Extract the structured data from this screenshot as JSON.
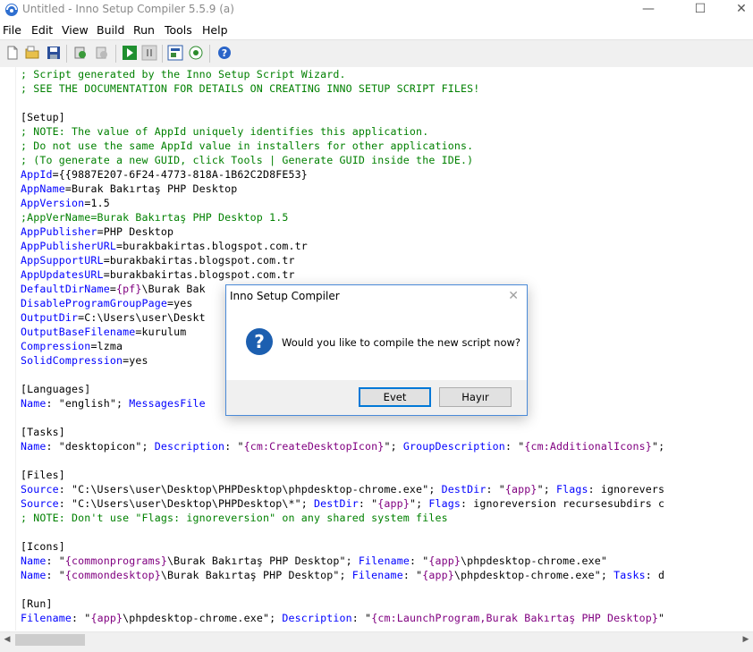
{
  "window": {
    "title": "Untitled - Inno Setup Compiler 5.5.9 (a)",
    "minimize_glyph": "—",
    "maximize_glyph": "☐",
    "close_glyph": "✕"
  },
  "menu": [
    "File",
    "Edit",
    "View",
    "Build",
    "Run",
    "Tools",
    "Help"
  ],
  "toolbar_icons": [
    "new-file-icon",
    "open-folder-icon",
    "save-icon",
    "compile-icon",
    "stop-compile-icon",
    "run-icon",
    "pause-icon",
    "wizard-icon",
    "target-icon",
    "help-icon"
  ],
  "editor": {
    "lines": [
      [
        {
          "t": "; Script generated by the Inno Setup Script Wizard.",
          "c": "cmt"
        }
      ],
      [
        {
          "t": "; SEE THE DOCUMENTATION FOR DETAILS ON CREATING INNO SETUP SCRIPT FILES!",
          "c": "cmt"
        }
      ],
      [],
      [
        {
          "t": "[Setup]",
          "c": "sec"
        }
      ],
      [
        {
          "t": "; NOTE: The value of AppId uniquely identifies this application.",
          "c": "cmt"
        }
      ],
      [
        {
          "t": "; Do not use the same AppId value in installers for other applications.",
          "c": "cmt"
        }
      ],
      [
        {
          "t": "; (To generate a new GUID, click Tools | Generate GUID inside the IDE.)",
          "c": "cmt"
        }
      ],
      [
        {
          "t": "AppId",
          "c": "key"
        },
        {
          "t": "={{9887E207-6F24-4773-818A-1B62C2D8FE53}",
          "c": ""
        }
      ],
      [
        {
          "t": "AppName",
          "c": "key"
        },
        {
          "t": "=Burak Bakırtaş PHP Desktop",
          "c": ""
        }
      ],
      [
        {
          "t": "AppVersion",
          "c": "key"
        },
        {
          "t": "=1.5",
          "c": ""
        }
      ],
      [
        {
          "t": ";AppVerName=Burak Bakırtaş PHP Desktop 1.5",
          "c": "cmt"
        }
      ],
      [
        {
          "t": "AppPublisher",
          "c": "key"
        },
        {
          "t": "=PHP Desktop",
          "c": ""
        }
      ],
      [
        {
          "t": "AppPublisherURL",
          "c": "key"
        },
        {
          "t": "=burakbakirtas.blogspot.com.tr",
          "c": ""
        }
      ],
      [
        {
          "t": "AppSupportURL",
          "c": "key"
        },
        {
          "t": "=burakbakirtas.blogspot.com.tr",
          "c": ""
        }
      ],
      [
        {
          "t": "AppUpdatesURL",
          "c": "key"
        },
        {
          "t": "=burakbakirtas.blogspot.com.tr",
          "c": ""
        }
      ],
      [
        {
          "t": "DefaultDirName",
          "c": "key"
        },
        {
          "t": "=",
          "c": ""
        },
        {
          "t": "{pf}",
          "c": "cst"
        },
        {
          "t": "\\Burak Bak",
          "c": ""
        }
      ],
      [
        {
          "t": "DisableProgramGroupPage",
          "c": "key"
        },
        {
          "t": "=yes",
          "c": ""
        }
      ],
      [
        {
          "t": "OutputDir",
          "c": "key"
        },
        {
          "t": "=C:\\Users\\user\\Deskt",
          "c": ""
        }
      ],
      [
        {
          "t": "OutputBaseFilename",
          "c": "key"
        },
        {
          "t": "=kurulum",
          "c": ""
        }
      ],
      [
        {
          "t": "Compression",
          "c": "key"
        },
        {
          "t": "=lzma",
          "c": ""
        }
      ],
      [
        {
          "t": "SolidCompression",
          "c": "key"
        },
        {
          "t": "=yes",
          "c": ""
        }
      ],
      [],
      [
        {
          "t": "[Languages]",
          "c": "sec"
        }
      ],
      [
        {
          "t": "Name",
          "c": "key"
        },
        {
          "t": ": \"english\"; ",
          "c": ""
        },
        {
          "t": "MessagesFile",
          "c": "key"
        }
      ],
      [],
      [
        {
          "t": "[Tasks]",
          "c": "sec"
        }
      ],
      [
        {
          "t": "Name",
          "c": "key"
        },
        {
          "t": ": \"desktopicon\"; ",
          "c": ""
        },
        {
          "t": "Description",
          "c": "key"
        },
        {
          "t": ": \"",
          "c": ""
        },
        {
          "t": "{cm:CreateDesktopIcon}",
          "c": "cst"
        },
        {
          "t": "\"; ",
          "c": ""
        },
        {
          "t": "GroupDescription",
          "c": "key"
        },
        {
          "t": ": \"",
          "c": ""
        },
        {
          "t": "{cm:AdditionalIcons}",
          "c": "cst"
        },
        {
          "t": "\";",
          "c": ""
        }
      ],
      [],
      [
        {
          "t": "[Files]",
          "c": "sec"
        }
      ],
      [
        {
          "t": "Source",
          "c": "key"
        },
        {
          "t": ": \"C:\\Users\\user\\Desktop\\PHPDesktop\\phpdesktop-chrome.exe\"; ",
          "c": ""
        },
        {
          "t": "DestDir",
          "c": "key"
        },
        {
          "t": ": \"",
          "c": ""
        },
        {
          "t": "{app}",
          "c": "cst"
        },
        {
          "t": "\"; ",
          "c": ""
        },
        {
          "t": "Flags",
          "c": "key"
        },
        {
          "t": ": ignorevers",
          "c": ""
        }
      ],
      [
        {
          "t": "Source",
          "c": "key"
        },
        {
          "t": ": \"C:\\Users\\user\\Desktop\\PHPDesktop\\*\"; ",
          "c": ""
        },
        {
          "t": "DestDir",
          "c": "key"
        },
        {
          "t": ": \"",
          "c": ""
        },
        {
          "t": "{app}",
          "c": "cst"
        },
        {
          "t": "\"; ",
          "c": ""
        },
        {
          "t": "Flags",
          "c": "key"
        },
        {
          "t": ": ignoreversion recursesubdirs c",
          "c": ""
        }
      ],
      [
        {
          "t": "; NOTE: Don't use \"Flags: ignoreversion\" on any shared system files",
          "c": "cmt"
        }
      ],
      [],
      [
        {
          "t": "[Icons]",
          "c": "sec"
        }
      ],
      [
        {
          "t": "Name",
          "c": "key"
        },
        {
          "t": ": \"",
          "c": ""
        },
        {
          "t": "{commonprograms}",
          "c": "cst"
        },
        {
          "t": "\\Burak Bakırtaş PHP Desktop\"; ",
          "c": ""
        },
        {
          "t": "Filename",
          "c": "key"
        },
        {
          "t": ": \"",
          "c": ""
        },
        {
          "t": "{app}",
          "c": "cst"
        },
        {
          "t": "\\phpdesktop-chrome.exe\"",
          "c": ""
        }
      ],
      [
        {
          "t": "Name",
          "c": "key"
        },
        {
          "t": ": \"",
          "c": ""
        },
        {
          "t": "{commondesktop}",
          "c": "cst"
        },
        {
          "t": "\\Burak Bakırtaş PHP Desktop\"; ",
          "c": ""
        },
        {
          "t": "Filename",
          "c": "key"
        },
        {
          "t": ": \"",
          "c": ""
        },
        {
          "t": "{app}",
          "c": "cst"
        },
        {
          "t": "\\phpdesktop-chrome.exe\"; ",
          "c": ""
        },
        {
          "t": "Tasks",
          "c": "key"
        },
        {
          "t": ": d",
          "c": ""
        }
      ],
      [],
      [
        {
          "t": "[Run]",
          "c": "sec"
        }
      ],
      [
        {
          "t": "Filename",
          "c": "key"
        },
        {
          "t": ": \"",
          "c": ""
        },
        {
          "t": "{app}",
          "c": "cst"
        },
        {
          "t": "\\phpdesktop-chrome.exe\"; ",
          "c": ""
        },
        {
          "t": "Description",
          "c": "key"
        },
        {
          "t": ": \"",
          "c": ""
        },
        {
          "t": "{cm:LaunchProgram,Burak Bakırtaş PHP Desktop}",
          "c": "cst"
        },
        {
          "t": "\"",
          "c": ""
        }
      ]
    ]
  },
  "dialog": {
    "title": "Inno Setup Compiler",
    "close_glyph": "✕",
    "icon_glyph": "?",
    "message": "Would you like to compile the new script now?",
    "yes_label": "Evet",
    "no_label": "Hayır"
  },
  "colors": {
    "comment": "#008000",
    "keyword": "#0000ff",
    "constant": "#800080",
    "dialog_border": "#4a8ad8",
    "default_button_border": "#0078d7"
  }
}
